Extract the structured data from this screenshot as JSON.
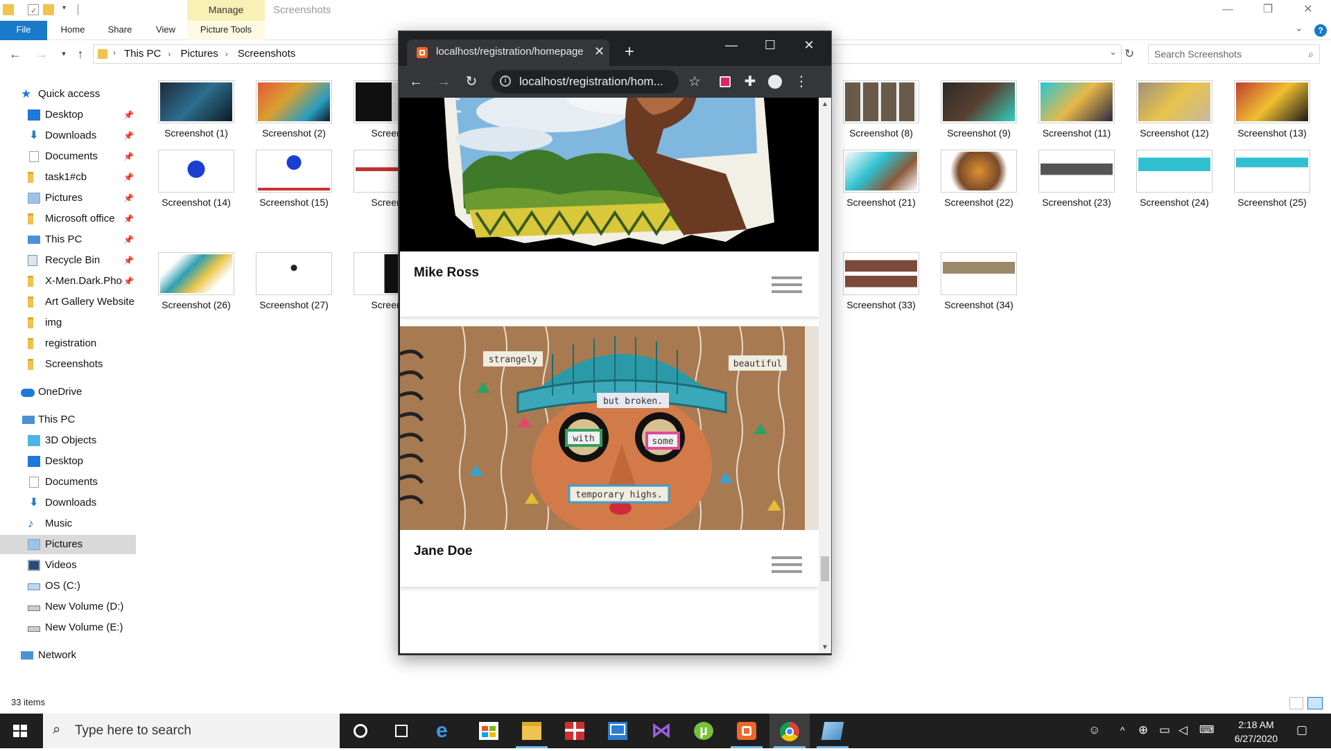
{
  "explorer": {
    "ribbon": {
      "context_tab": "Manage",
      "window_title": "Screenshots",
      "file_tab": "File",
      "tabs": [
        "Home",
        "Share",
        "View",
        "Picture Tools"
      ]
    },
    "address": {
      "crumbs": [
        "This PC",
        "Pictures",
        "Screenshots"
      ],
      "search_placeholder": "Search Screenshots"
    },
    "nav": {
      "quick_access": "Quick access",
      "quick_items": [
        "Desktop",
        "Downloads",
        "Documents",
        "task1#cb",
        "Pictures",
        "Microsoft office",
        "This PC",
        "Recycle Bin",
        "X-Men.Dark.Phoe",
        "Art Gallery Website",
        "img",
        "registration",
        "Screenshots"
      ],
      "onedrive": "OneDrive",
      "this_pc": "This PC",
      "pc_items": [
        "3D Objects",
        "Desktop",
        "Documents",
        "Downloads",
        "Music",
        "Pictures",
        "Videos",
        "OS (C:)",
        "New Volume (D:)",
        "New Volume (E:)"
      ],
      "network": "Network"
    },
    "files": [
      "Screenshot (1)",
      "Screenshot (2)",
      "Screensh",
      "Screenshot (8)",
      "Screenshot (9)",
      "Screenshot (11)",
      "Screenshot (12)",
      "Screenshot (13)",
      "Screenshot (14)",
      "Screenshot (15)",
      "Screensh",
      "Screenshot (21)",
      "Screenshot (22)",
      "Screenshot (23)",
      "Screenshot (24)",
      "Screenshot (25)",
      "Screenshot (26)",
      "Screenshot (27)",
      "Screensh",
      "Screenshot (33)",
      "Screenshot (34)"
    ],
    "status": "33 items"
  },
  "chrome": {
    "tab_title": "localhost/registration/homepage",
    "url": "localhost/registration/hom...",
    "scroll_position": 0.88,
    "cards": [
      {
        "name": "Mike Ross"
      },
      {
        "name": "Jane Doe",
        "artwork_words": [
          "strangely",
          "beautiful",
          "but broken.",
          "with",
          "some",
          "temporary highs."
        ]
      }
    ]
  },
  "taskbar": {
    "search_placeholder": "Type here to search",
    "time": "2:18 AM",
    "date": "6/27/2020"
  },
  "colors": {
    "explorer_accent": "#1979ca",
    "manage_tab": "#f9f0b5",
    "chrome_frame": "#202124",
    "chrome_toolbar": "#35363a",
    "taskbar": "#1f1f1f"
  }
}
